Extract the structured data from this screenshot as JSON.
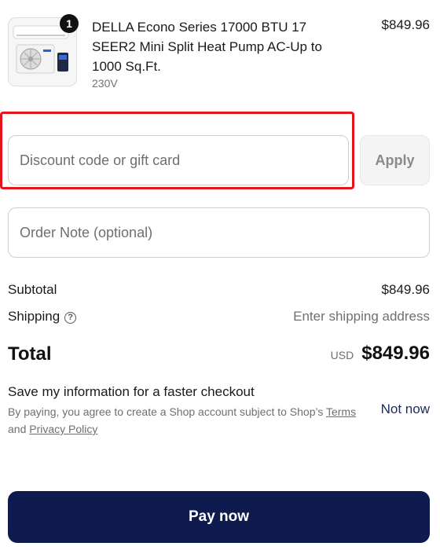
{
  "product": {
    "quantity": "1",
    "title": "DELLA Econo Series 17000 BTU 17 SEER2 Mini Split Heat Pump AC-Up to 1000 Sq.Ft.",
    "variant": "230V",
    "price": "$849.96",
    "image_icon": "mini-split-ac-image"
  },
  "discount": {
    "placeholder": "Discount code or gift card",
    "apply_label": "Apply"
  },
  "note": {
    "placeholder": "Order Note (optional)"
  },
  "summary": {
    "subtotal_label": "Subtotal",
    "subtotal_value": "$849.96",
    "shipping_label": "Shipping",
    "shipping_help_icon": "?",
    "shipping_value": "Enter shipping address",
    "total_label": "Total",
    "total_currency": "USD",
    "total_value": "$849.96"
  },
  "save_info": {
    "title": "Save my information for a faster checkout",
    "sub_prefix": "By paying, you agree to create a Shop account subject to Shop’s",
    "terms_link": "Terms",
    "and_text": "and",
    "privacy_link": "Privacy Policy",
    "not_now": "Not now"
  },
  "pay_button": "Pay now",
  "colors": {
    "highlight": "#e5141b",
    "pay_button_bg": "#0f1a4f",
    "link": "#1a2a5c"
  }
}
